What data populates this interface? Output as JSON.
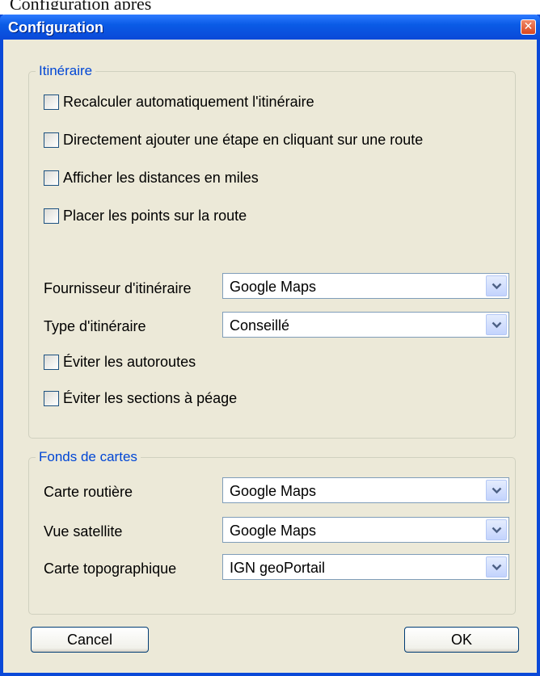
{
  "background_text": "Configuration après",
  "window": {
    "title": "Configuration"
  },
  "itinerary": {
    "group_title": "Itinéraire",
    "options": [
      "Recalculer automatiquement l'itinéraire",
      "Directement ajouter une étape en cliquant sur une route",
      "Afficher les distances en miles",
      "Placer les points sur la route"
    ],
    "provider_label": "Fournisseur d'itinéraire",
    "provider_value": "Google Maps",
    "type_label": "Type d'itinéraire",
    "type_value": "Conseillé",
    "avoid_options": [
      "Éviter les autoroutes",
      "Éviter les sections à péage"
    ]
  },
  "maps": {
    "group_title": "Fonds de cartes",
    "road_label": "Carte routière",
    "road_value": "Google Maps",
    "satellite_label": "Vue satellite",
    "satellite_value": "Google Maps",
    "topo_label": "Carte topographique",
    "topo_value": "IGN geoPortail"
  },
  "buttons": {
    "cancel": "Cancel",
    "ok": "OK"
  }
}
